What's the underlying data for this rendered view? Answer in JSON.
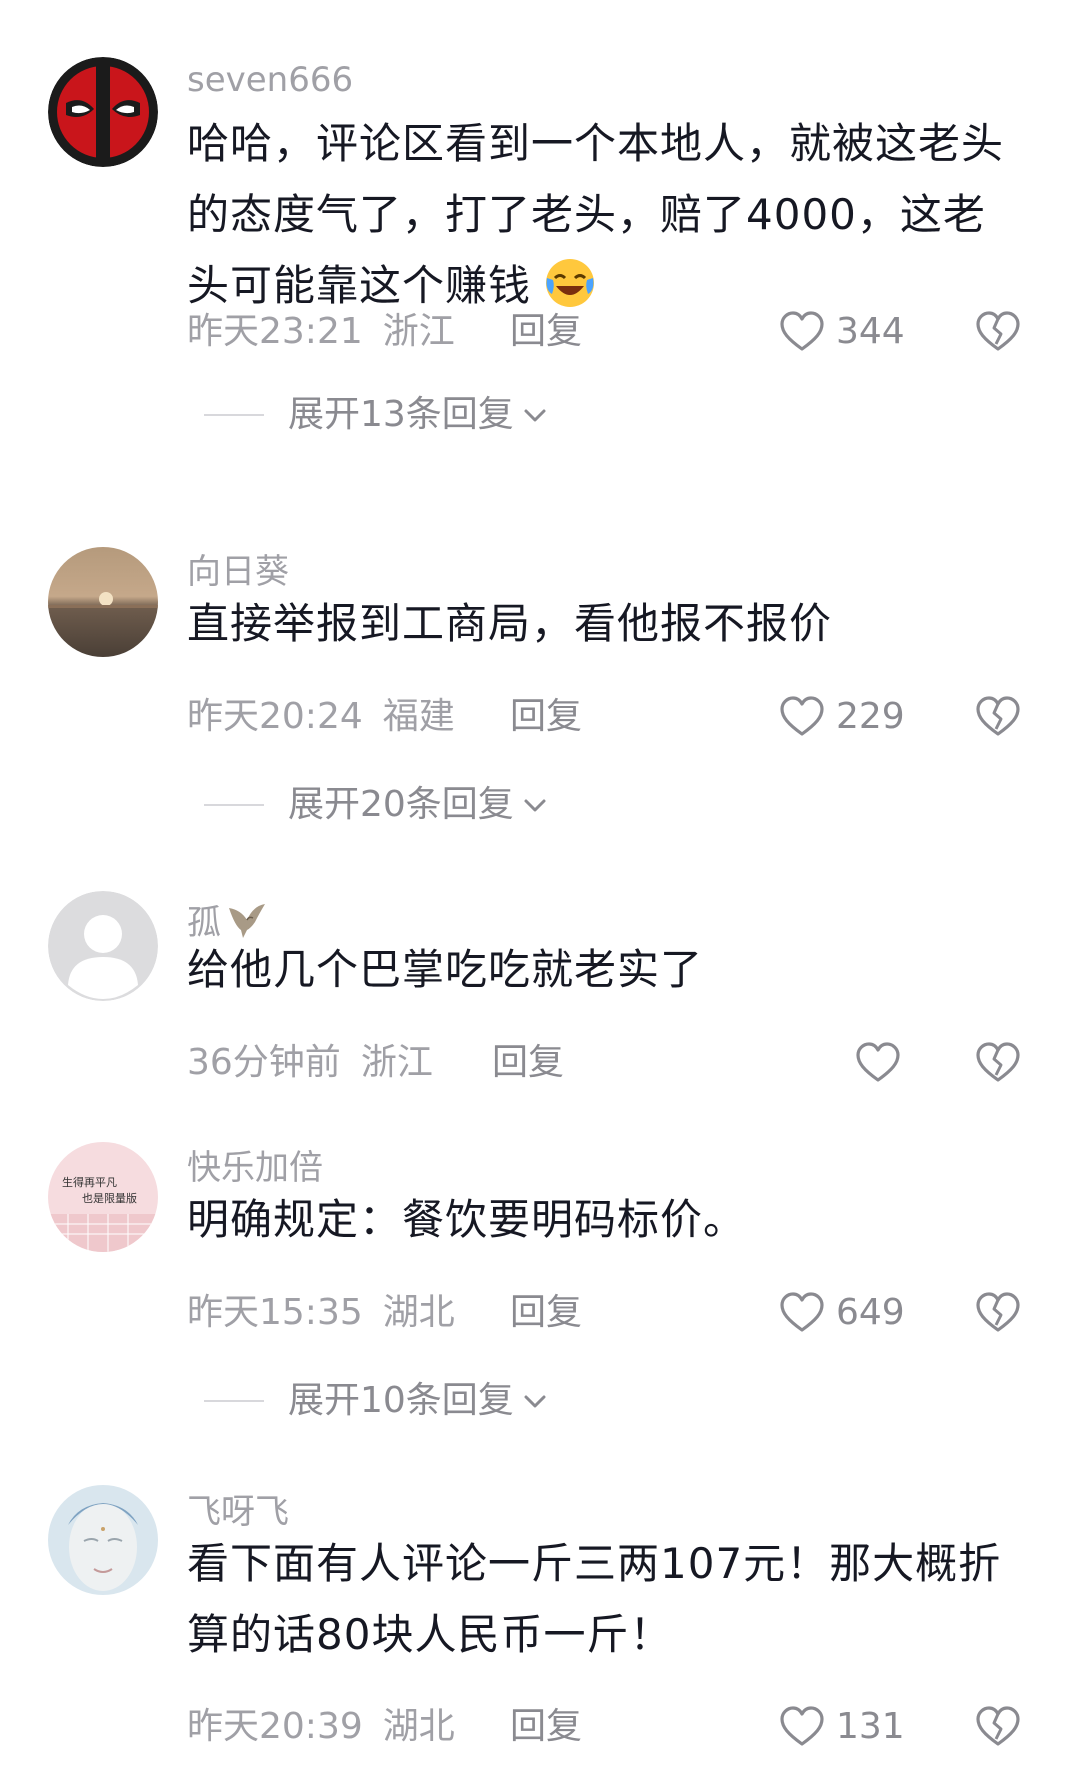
{
  "comments": [
    {
      "username": "seven666",
      "text": "哈哈，评论区看到一个本地人，就被这老头的态度气了，打了老头，赔了4000，这老头可能靠这个赚钱",
      "emoji": "laughing-crying-emoji",
      "time": "昨天23:21",
      "region": "浙江",
      "reply_label": "回复",
      "likes": "344",
      "expand_label": "展开13条回复"
    },
    {
      "username": "向日葵",
      "text": "直接举报到工商局，看他报不报价",
      "time": "昨天20:24",
      "region": "福建",
      "reply_label": "回复",
      "likes": "229",
      "expand_label": "展开20条回复"
    },
    {
      "username": "孤",
      "name_icon": "eagle-icon",
      "text": "给他几个巴掌吃吃就老实了",
      "time": "36分钟前",
      "region": "浙江",
      "reply_label": "回复",
      "likes": ""
    },
    {
      "username": "快乐加倍",
      "text": "明确规定：餐饮要明码标价。",
      "time": "昨天15:35",
      "region": "湖北",
      "reply_label": "回复",
      "likes": "649",
      "expand_label": "展开10条回复"
    },
    {
      "username": "飞呀飞",
      "text": "看下面有人评论一斤三两107元！那大概折算的话80块人民币一斤！",
      "time": "昨天20:39",
      "region": "湖北",
      "reply_label": "回复",
      "likes": "131"
    }
  ],
  "avatar_texts": {
    "line1": "生得再平凡",
    "line2": "也是限量版"
  },
  "colors": {
    "text_primary": "#161823",
    "text_secondary": "#a0a0a6",
    "text_action": "#8a8a90"
  }
}
